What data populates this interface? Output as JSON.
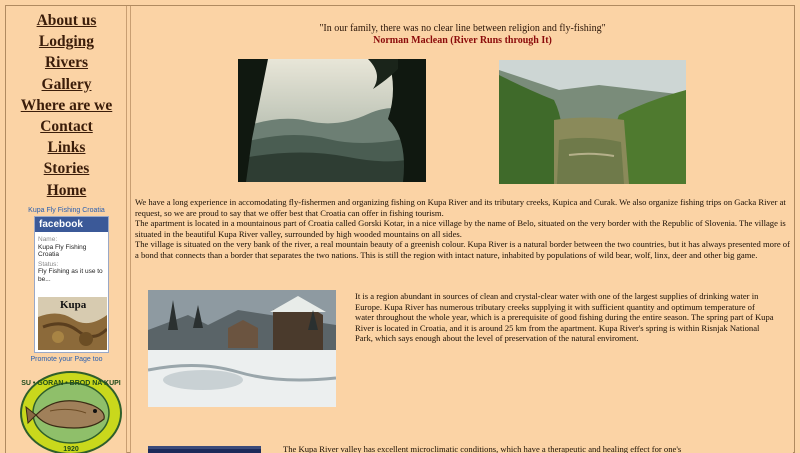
{
  "nav": {
    "items": [
      "About us",
      "Lodging",
      "Rivers",
      "Gallery",
      "Where are we",
      "Contact",
      "Links",
      "Stories",
      "Home"
    ]
  },
  "facebook": {
    "caption": "Kupa Fly Fishing Croatia",
    "brand": "facebook",
    "name_label": "Name:",
    "name_value": "Kupa Fly Fishing Croatia",
    "status_label": "Status:",
    "status_value": "Fly Fishing as it use to be...",
    "image_word": "Kupa",
    "promo": "Promote your Page too"
  },
  "badge": {
    "top_text": "SU • GORAN • BROD NA KUPI",
    "year": "1920",
    "icon": "fish-icon"
  },
  "quote": {
    "text": "\"In our family, there was no clear line between religion and fly-fishing\"",
    "author": "Norman Maclean (River Runs through It)"
  },
  "content": {
    "para1": "We have a long experience in accomodating fly-fishermen and organizing fishing on Kupa River and its tributary creeks, Kupica and Curak.  We also organize fishing trips on Gacka River at request, so we are proud to say that we offer best that Croatia can offer in fishing tourism.",
    "para2": "The apartment is located in a mountainous part of Croatia called Gorski Kotar, in a nice village by the name of Belo, situated on the very border with the Republic of Slovenia. The village is situated in the beautiful Kupa River valley, surrounded by high wooded mountains on all sides.",
    "para3": "The village is situated on the very bank of the river, a real mountain beauty of a greenish colour. Kupa River is a natural border between the two countries, but it has always presented more of a bond that connects than a border that separates the two nations. This is still the region with intact nature, inhabited by populations of wild bear, wolf, linx, deer and other big game.",
    "para4": "It is a region abundant in sources of clean and crystal-clear water with one of the largest supplies of drinking water in Europe. Kupa River has numerous tributary creeks supplying it with sufficient quantity and optimum temperature of water throughout the whole year, which is a prerequisite of  good fishing during the entire season. The spring part of Kupa River is located in Croatia, and it is around 25 km from the apartment. Kupa River's spring is within Risnjak National Park, which says enough about the level of  preservation of the natural enviroment.",
    "para5": "The Kupa River valley has excellent microclimatic conditions, which have a therapeutic and healing effect for one's"
  },
  "colors": {
    "background": "#fbd3a5",
    "nav_link": "#3b1d0a",
    "author": "#8b0b0b",
    "facebook_blue": "#3b5998",
    "link_blue": "#2a5fb0"
  }
}
